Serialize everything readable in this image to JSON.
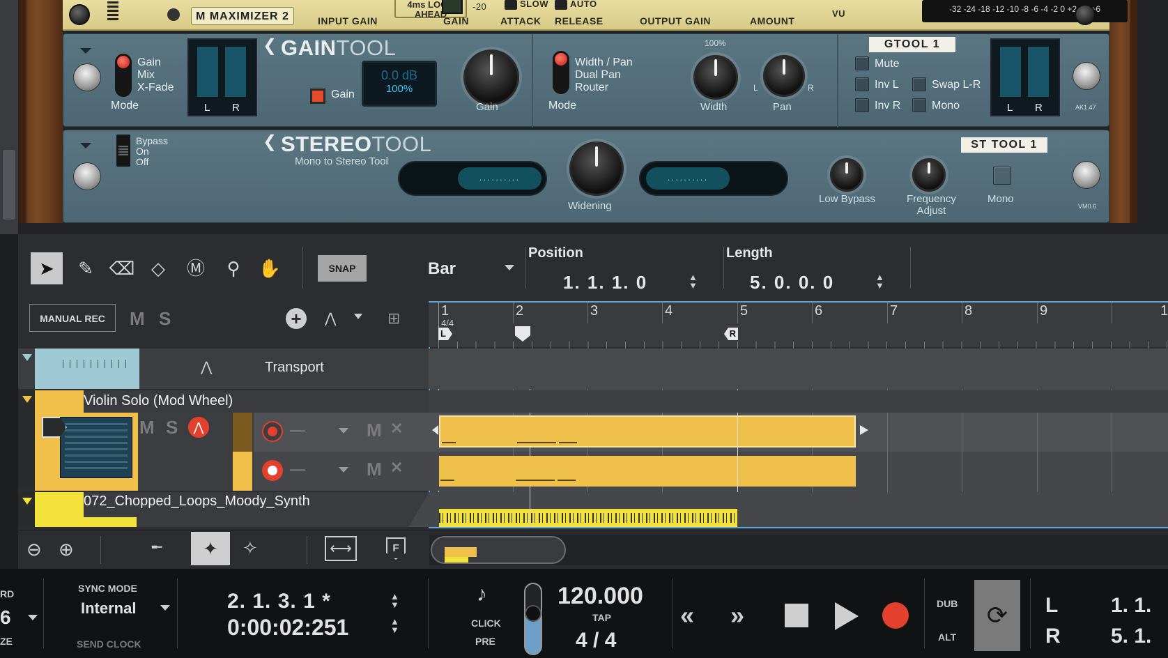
{
  "rack": {
    "maximizer": {
      "name_tag": "M MAXIMIZER 2",
      "labels": {
        "input_gain": "INPUT GAIN",
        "lookahead": "4ms LOOK AHEAD",
        "gain": "GAIN",
        "gain_val": "-20",
        "attack": "ATTACK",
        "release": "RELEASE",
        "slow": "SLOW",
        "auto": "AUTO",
        "output_gain": "OUTPUT GAIN",
        "amount": "AMOUNT",
        "vu": "VU"
      },
      "scale": "-32 -24 -18 -12 -10 -8  -6  -4  -2   0  +2 +4 +6"
    },
    "gaintool": {
      "brand_bold": "GAIN",
      "brand_light": "TOOL",
      "mode_options": [
        "Gain",
        "Mix",
        "X-Fade"
      ],
      "mode_label": "Mode",
      "meter_l": "L",
      "meter_r": "R",
      "gain_led_label": "Gain",
      "display_db": "0.0 dB",
      "display_pct": "100%",
      "gain_knob_label": "Gain",
      "router_options": [
        "Width / Pan",
        "Dual Pan",
        "Router"
      ],
      "router_mode_label": "Mode",
      "width_top": "100%",
      "width_label": "Width",
      "pan_l": "L",
      "pan_r": "R",
      "pan_label": "Pan",
      "name_tag": "GTOOL 1",
      "checks": {
        "mute": "Mute",
        "inv_l": "Inv L",
        "swap": "Swap L-R",
        "inv_r": "Inv R",
        "mono": "Mono"
      },
      "version": "AK1.47"
    },
    "stereotool": {
      "brand_bold": "STEREO",
      "brand_light": "TOOL",
      "subtitle": "Mono to Stereo Tool",
      "bypass_options": [
        "Bypass",
        "On",
        "Off"
      ],
      "left_display": "..........",
      "right_display": "..........",
      "widening_label": "Widening",
      "low_bypass_label": "Low Bypass",
      "freq_label_1": "Frequency",
      "freq_label_2": "Adjust",
      "mono_label": "Mono",
      "name_tag": "ST TOOL 1",
      "version": "VM0.6"
    }
  },
  "toolbar": {
    "snap": "SNAP",
    "snap_value": "Bar",
    "position_label": "Position",
    "position_value": "1.  1.  1.    0",
    "length_label": "Length",
    "length_value": "5.  0.  0.    0"
  },
  "sequencer": {
    "manual_rec": "MANUAL REC",
    "m": "M",
    "s": "S",
    "bars": [
      "1",
      "2",
      "3",
      "4",
      "5",
      "6",
      "7",
      "8",
      "9",
      "1"
    ],
    "time_sig": "4/4",
    "loop_l": "L",
    "loop_r": "R",
    "transport_track": "Transport",
    "violin_track": "Violin Solo (Mod Wheel)",
    "loops_track": "072_Chopped_Loops_Moody_Synth",
    "lane_m": "M",
    "lane_x": "✕",
    "lane_dash": "—"
  },
  "transport": {
    "left_partial": [
      "RD",
      "6",
      "ZE"
    ],
    "sync_mode_label": "SYNC MODE",
    "sync_mode_value": "Internal",
    "send_clock": "SEND CLOCK",
    "bars_pos": "2.   1.   3.      1 *",
    "time_pos": "0:00:02:251",
    "click": "CLICK",
    "pre": "PRE",
    "tempo": "120.000",
    "tap": "TAP",
    "signature": "4 / 4",
    "dub": "DUB",
    "alt": "ALT",
    "loop_l": "L",
    "loop_r": "R",
    "loop_l_val": "1.  1.",
    "loop_r_val": "5.  1."
  },
  "colors": {
    "accent_blue": "#5ea8e0",
    "clip_yellow": "#efc04b",
    "audio_yellow": "#f3e23a",
    "rack_blue": "#526e7a",
    "rec_red": "#e3412e"
  }
}
